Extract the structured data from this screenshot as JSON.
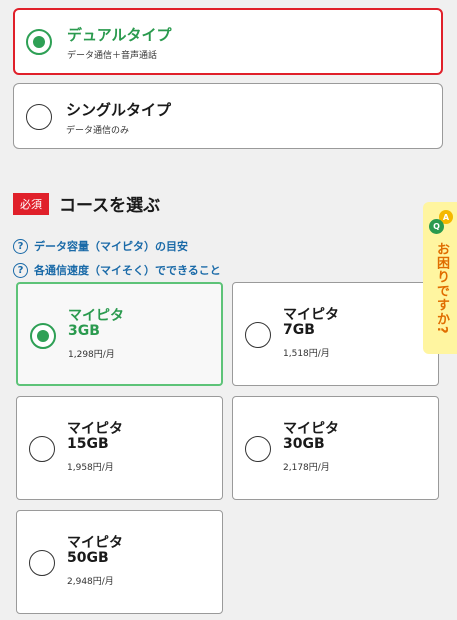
{
  "sim_types": [
    {
      "title": "デュアルタイプ",
      "sub": "データ通信＋音声通話",
      "selected": true
    },
    {
      "title": "シングルタイプ",
      "sub": "データ通信のみ",
      "selected": false
    }
  ],
  "course": {
    "badge": "必須",
    "title": "コースを選ぶ"
  },
  "help_links": [
    "データ容量（マイピタ）の目安",
    "各通信速度（マイそく）でできること"
  ],
  "plans": [
    {
      "name": "マイピタ",
      "size": "3GB",
      "price": "1,298円/月",
      "selected": true
    },
    {
      "name": "マイピタ",
      "size": "7GB",
      "price": "1,518円/月",
      "selected": false
    },
    {
      "name": "マイピタ",
      "size": "15GB",
      "price": "1,958円/月",
      "selected": false
    },
    {
      "name": "マイピタ",
      "size": "30GB",
      "price": "2,178円/月",
      "selected": false
    },
    {
      "name": "マイピタ",
      "size": "50GB",
      "price": "2,948円/月",
      "selected": false
    }
  ],
  "faq_tab": {
    "text": "お困りですか?",
    "badge_a": "A",
    "badge_q": "Q"
  }
}
